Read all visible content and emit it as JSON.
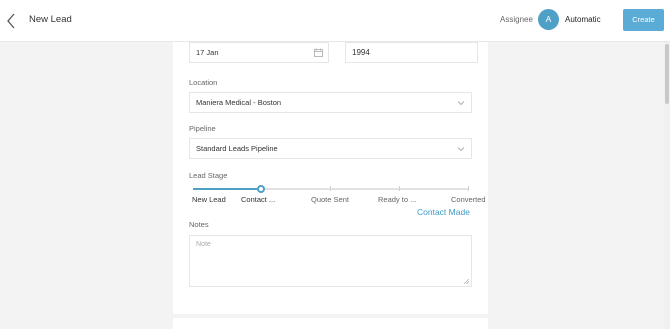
{
  "header": {
    "title": "New Lead",
    "assignee_label": "Assignee",
    "avatar_initial": "A",
    "assignee_value": "Automatic",
    "create_label": "Create"
  },
  "form": {
    "date_value": "17 Jan",
    "year_value": "1994",
    "location_label": "Location",
    "location_value": "Maniera Medical - Boston",
    "pipeline_label": "Pipeline",
    "pipeline_value": "Standard Leads Pipeline",
    "stage_label": "Lead Stage",
    "stages": [
      "New Lead",
      "Contact ...",
      "Quote Sent",
      "Ready to ...",
      "Converted"
    ],
    "current_stage": "Contact Made",
    "stage_progress_percent": 25,
    "notes_label": "Notes",
    "notes_placeholder": "Note"
  },
  "colors": {
    "accent": "#4fa0c6",
    "create_button": "#5aabd6"
  },
  "icons": {
    "back": "chevron-left-icon",
    "date": "calendar-icon",
    "dropdown": "chevron-down-icon"
  }
}
